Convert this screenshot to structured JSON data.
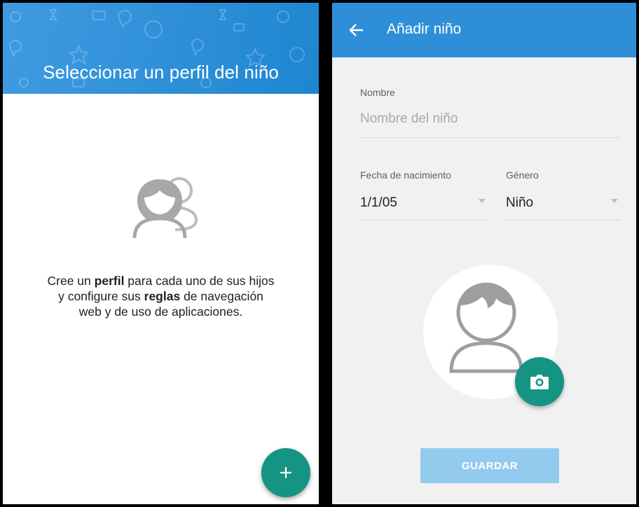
{
  "left_screen": {
    "header_title": "Seleccionar un perfil del niño",
    "empty_state": {
      "line1_pre": "Cree un ",
      "line1_bold": "perfil",
      "line1_post": " para cada uno de sus hijos",
      "line2_pre": "y configure sus ",
      "line2_bold": "reglas",
      "line2_post": " de navegación",
      "line3": "web y de uso de aplicaciones."
    },
    "fab_icon": "plus-icon"
  },
  "right_screen": {
    "appbar_title": "Añadir niño",
    "back_icon": "arrow-left-icon",
    "name_field": {
      "label": "Nombre",
      "placeholder": "Nombre del niño",
      "value": ""
    },
    "birthdate_field": {
      "label": "Fecha de nacimiento",
      "value": "1/1/05"
    },
    "gender_field": {
      "label": "Género",
      "value": "Niño"
    },
    "avatar_icon": "child-avatar-icon",
    "camera_icon": "camera-icon",
    "save_label": "GUARDAR"
  },
  "colors": {
    "primary": "#2e8fd8",
    "accent": "#159383",
    "save_disabled": "#93cbef"
  }
}
